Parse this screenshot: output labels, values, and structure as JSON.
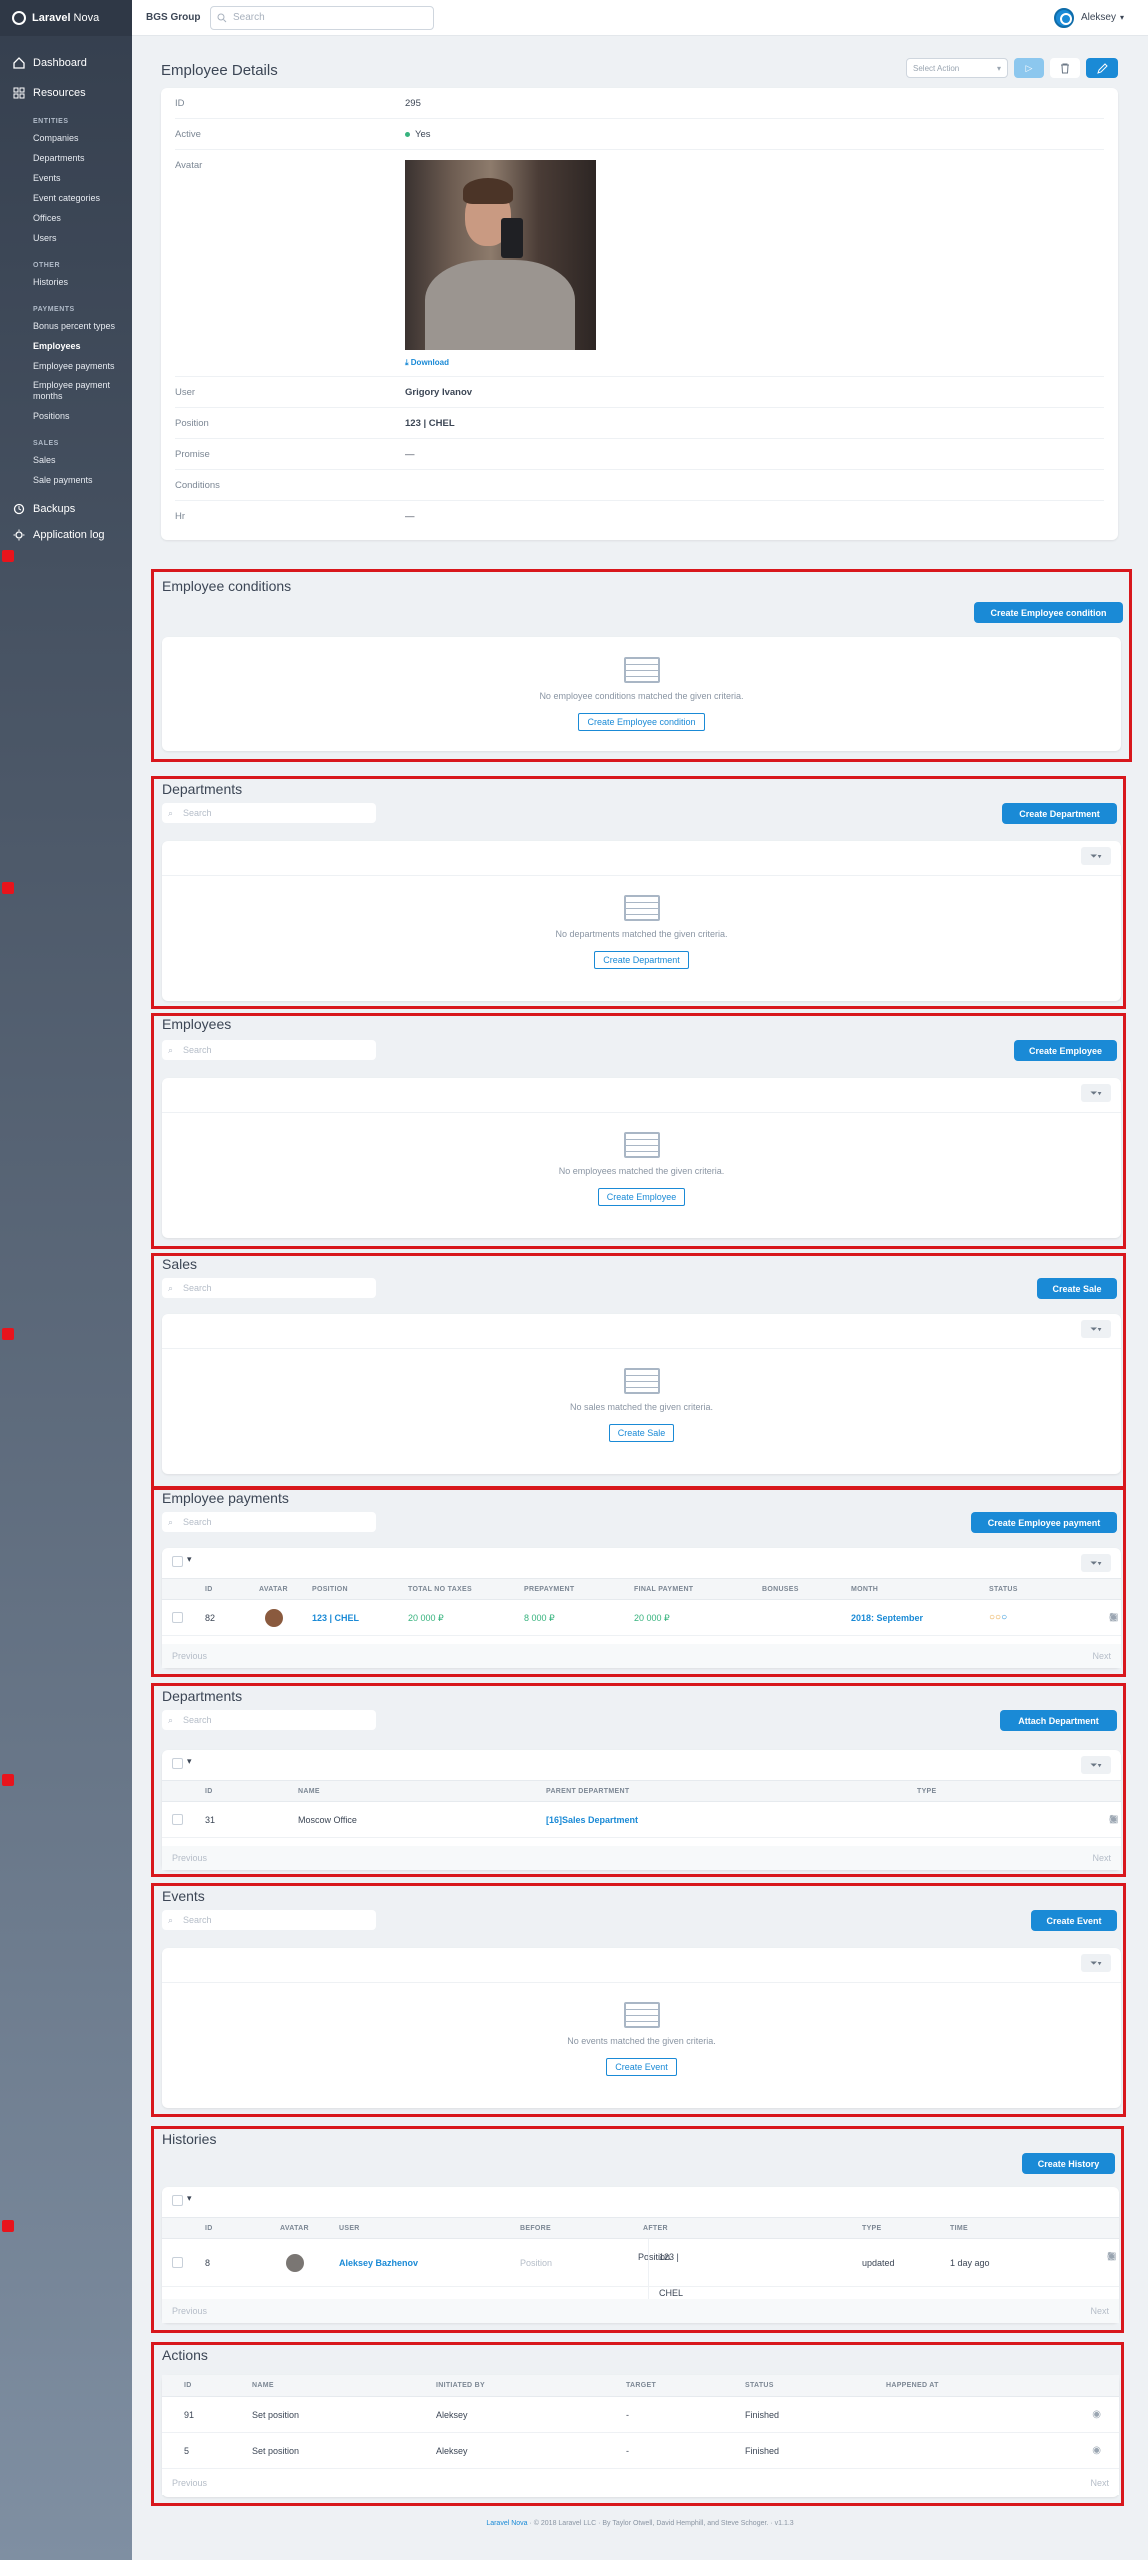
{
  "brand": {
    "name_bold": "Laravel",
    "name": "Nova"
  },
  "sidebar": {
    "dashboard": "Dashboard",
    "resources": "Resources",
    "sections": [
      {
        "title": "ENTITIES",
        "items": [
          "Companies",
          "Departments",
          "Events",
          "Event categories",
          "Offices",
          "Users"
        ]
      },
      {
        "title": "OTHER",
        "items": [
          "Histories"
        ]
      },
      {
        "title": "PAYMENTS",
        "items": [
          "Bonus percent types",
          "Employees",
          "Employee payments",
          "Employee payment months",
          "Positions"
        ]
      },
      {
        "title": "SALES",
        "items": [
          "Sales",
          "Sale payments"
        ]
      }
    ],
    "backups": "Backups",
    "app_log": "Application log"
  },
  "header": {
    "org": "BGS Group",
    "search_placeholder": "Search",
    "user": "Aleksey"
  },
  "details": {
    "title": "Employee Details",
    "select_action": "Select Action",
    "rows": {
      "id_label": "ID",
      "id": "295",
      "active_label": "Active",
      "active": "Yes",
      "avatar_label": "Avatar",
      "download": "Download",
      "user_label": "User",
      "user": "Grigory Ivanov",
      "position_label": "Position",
      "position": "123 | CHEL",
      "promise_label": "Promise",
      "promise": "—",
      "conditions_label": "Conditions",
      "hr_label": "Hr",
      "hr": "—"
    }
  },
  "conditions": {
    "title": "Employee conditions",
    "create": "Create Employee condition",
    "empty": "No employee conditions matched the given criteria."
  },
  "departments_empty": {
    "title": "Departments",
    "create": "Create Department",
    "empty": "No departments matched the given criteria.",
    "search": "Search"
  },
  "employees": {
    "title": "Employees",
    "create": "Create Employee",
    "empty": "No employees matched the given criteria.",
    "search": "Search"
  },
  "sales": {
    "title": "Sales",
    "create": "Create Sale",
    "empty": "No sales matched the given criteria.",
    "search": "Search"
  },
  "payments": {
    "title": "Employee payments",
    "create": "Create Employee payment",
    "search": "Search",
    "cols": [
      "ID",
      "AVATAR",
      "POSITION",
      "TOTAL NO TAXES",
      "PREPAYMENT",
      "FINAL PAYMENT",
      "BONUSES",
      "MONTH",
      "STATUS"
    ],
    "row": {
      "id": "82",
      "position": "123 | CHEL",
      "total": "20 000 ₽",
      "prepayment": "8 000 ₽",
      "final": "20 000 ₽",
      "month": "2018: September"
    },
    "prev": "Previous",
    "next": "Next"
  },
  "departments": {
    "title": "Departments",
    "attach": "Attach Department",
    "search": "Search",
    "cols": [
      "ID",
      "NAME",
      "PARENT DEPARTMENT",
      "TYPE"
    ],
    "row": {
      "id": "31",
      "name": "Moscow Office",
      "parent": "[16]Sales Department"
    },
    "prev": "Previous",
    "next": "Next"
  },
  "events": {
    "title": "Events",
    "create": "Create Event",
    "empty": "No events matched the given criteria.",
    "search": "Search"
  },
  "histories": {
    "title": "Histories",
    "create": "Create History",
    "cols": [
      "ID",
      "AVATAR",
      "USER",
      "BEFORE",
      "AFTER",
      "TYPE",
      "TIME"
    ],
    "row": {
      "id": "8",
      "user": "Aleksey Bazhenov",
      "before": "Position",
      "after_label": "Position",
      "after": "123 | CHEL",
      "type": "updated",
      "time": "1 day ago"
    },
    "prev": "Previous",
    "next": "Next"
  },
  "actions": {
    "title": "Actions",
    "cols": [
      "ID",
      "NAME",
      "INITIATED BY",
      "TARGET",
      "STATUS",
      "HAPPENED AT"
    ],
    "rows": [
      {
        "id": "91",
        "name": "Set position",
        "by": "Aleksey",
        "target": "-",
        "status": "Finished"
      },
      {
        "id": "5",
        "name": "Set position",
        "by": "Aleksey",
        "target": "-",
        "status": "Finished"
      }
    ],
    "prev": "Previous",
    "next": "Next"
  },
  "footer": {
    "link": "Laravel Nova",
    "text": "· © 2018 Laravel LLC · By Taylor Otwell, David Hemphill, and Steve Schoger. · v1.1.3"
  }
}
